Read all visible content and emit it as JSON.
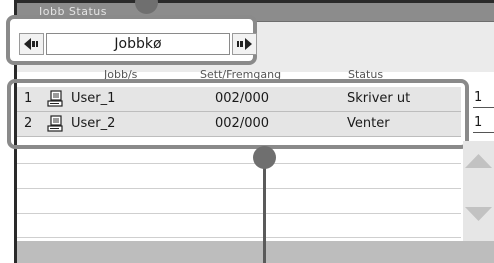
{
  "window": {
    "title": "Jobb Status"
  },
  "queue_selector": {
    "value": "Jobbkø",
    "prev_icon": "arrow-left-icon",
    "next_icon": "arrow-right-icon"
  },
  "columns": {
    "job": "Jobb/s",
    "sets": "Sett/Fremgang",
    "status": "Status"
  },
  "jobs": [
    {
      "number": "1",
      "icon": "computer-icon",
      "name": "User_1",
      "count": "002/000",
      "status": "Skriver ut",
      "edge": "1"
    },
    {
      "number": "2",
      "icon": "computer-icon",
      "name": "User_2",
      "count": "002/000",
      "status": "Venter",
      "edge": "1"
    }
  ],
  "scrollbar": {
    "up_icon": "triangle-up-icon",
    "down_icon": "triangle-down-icon"
  },
  "colors": {
    "row_background": "#e5e5e5",
    "outline": "#8a8a8a",
    "callout": "#6f6f6f"
  }
}
